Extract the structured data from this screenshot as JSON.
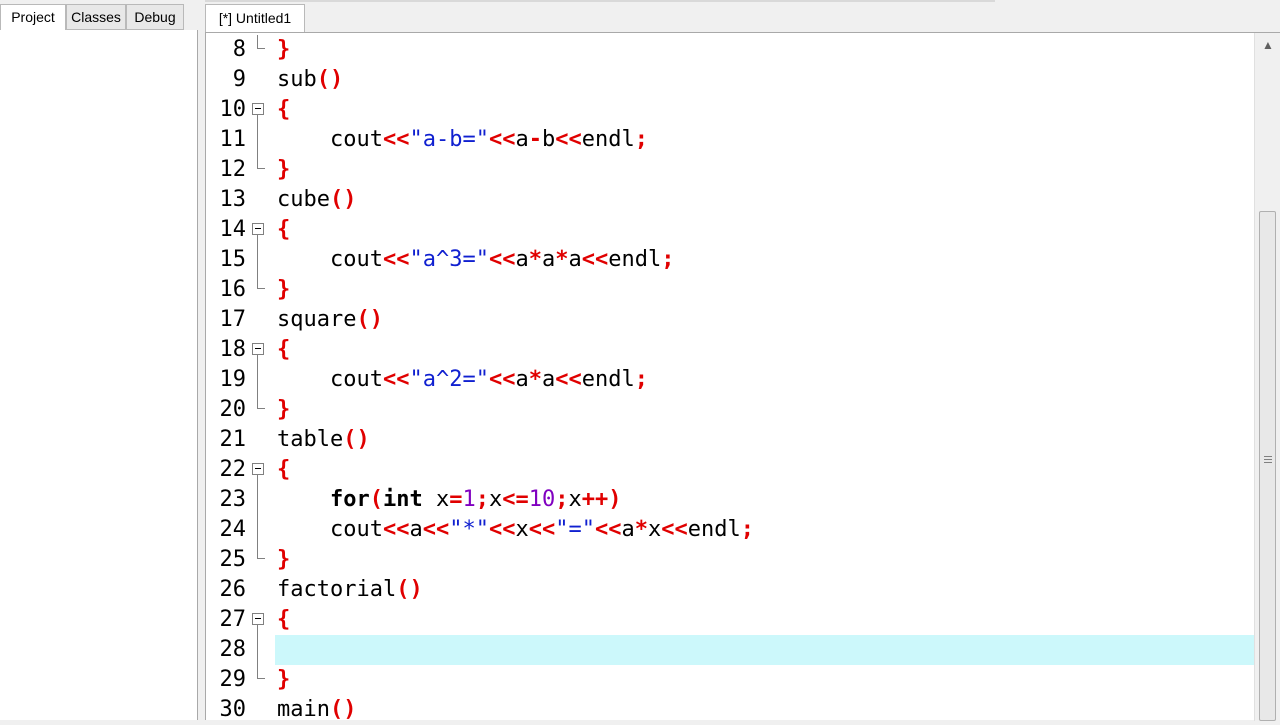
{
  "left_panel": {
    "tabs": [
      "Project",
      "Classes",
      "Debug"
    ],
    "active_tab": "Project"
  },
  "editor": {
    "file_tab_label": "[*] Untitled1",
    "current_line": 28,
    "lines": [
      {
        "n": "8",
        "fold": "end",
        "tokens": [
          [
            "}",
            "punct"
          ]
        ]
      },
      {
        "n": "9",
        "fold": "",
        "tokens": [
          [
            "sub",
            "plain"
          ],
          [
            "()",
            "punct"
          ]
        ]
      },
      {
        "n": "10",
        "fold": "start",
        "tokens": [
          [
            "{",
            "punct"
          ]
        ]
      },
      {
        "n": "11",
        "fold": "mid",
        "tokens": [
          [
            "    cout",
            "plain"
          ],
          [
            "<<",
            "punct"
          ],
          [
            "\"a-b=\"",
            "str"
          ],
          [
            "<<",
            "punct"
          ],
          [
            "a",
            "plain"
          ],
          [
            "-",
            "punct"
          ],
          [
            "b",
            "plain"
          ],
          [
            "<<",
            "punct"
          ],
          [
            "endl",
            "plain"
          ],
          [
            ";",
            "punct"
          ]
        ]
      },
      {
        "n": "12",
        "fold": "end",
        "tokens": [
          [
            "}",
            "punct"
          ]
        ]
      },
      {
        "n": "13",
        "fold": "",
        "tokens": [
          [
            "cube",
            "plain"
          ],
          [
            "()",
            "punct"
          ]
        ]
      },
      {
        "n": "14",
        "fold": "start",
        "tokens": [
          [
            "{",
            "punct"
          ]
        ]
      },
      {
        "n": "15",
        "fold": "mid",
        "tokens": [
          [
            "    cout",
            "plain"
          ],
          [
            "<<",
            "punct"
          ],
          [
            "\"a^3=\"",
            "str"
          ],
          [
            "<<",
            "punct"
          ],
          [
            "a",
            "plain"
          ],
          [
            "*",
            "punct"
          ],
          [
            "a",
            "plain"
          ],
          [
            "*",
            "punct"
          ],
          [
            "a",
            "plain"
          ],
          [
            "<<",
            "punct"
          ],
          [
            "endl",
            "plain"
          ],
          [
            ";",
            "punct"
          ]
        ]
      },
      {
        "n": "16",
        "fold": "end",
        "tokens": [
          [
            "}",
            "punct"
          ]
        ]
      },
      {
        "n": "17",
        "fold": "",
        "tokens": [
          [
            "square",
            "plain"
          ],
          [
            "()",
            "punct"
          ]
        ]
      },
      {
        "n": "18",
        "fold": "start",
        "tokens": [
          [
            "{",
            "punct"
          ]
        ]
      },
      {
        "n": "19",
        "fold": "mid",
        "tokens": [
          [
            "    cout",
            "plain"
          ],
          [
            "<<",
            "punct"
          ],
          [
            "\"a^2=\"",
            "str"
          ],
          [
            "<<",
            "punct"
          ],
          [
            "a",
            "plain"
          ],
          [
            "*",
            "punct"
          ],
          [
            "a",
            "plain"
          ],
          [
            "<<",
            "punct"
          ],
          [
            "endl",
            "plain"
          ],
          [
            ";",
            "punct"
          ]
        ]
      },
      {
        "n": "20",
        "fold": "end",
        "tokens": [
          [
            "}",
            "punct"
          ]
        ]
      },
      {
        "n": "21",
        "fold": "",
        "tokens": [
          [
            "table",
            "plain"
          ],
          [
            "()",
            "punct"
          ]
        ]
      },
      {
        "n": "22",
        "fold": "start",
        "tokens": [
          [
            "{",
            "punct"
          ]
        ]
      },
      {
        "n": "23",
        "fold": "mid",
        "tokens": [
          [
            "    ",
            "plain"
          ],
          [
            "for",
            "kw"
          ],
          [
            "(",
            "punct"
          ],
          [
            "int",
            "kw"
          ],
          [
            " x",
            "plain"
          ],
          [
            "=",
            "punct"
          ],
          [
            "1",
            "num"
          ],
          [
            ";",
            "punct"
          ],
          [
            "x",
            "plain"
          ],
          [
            "<=",
            "punct"
          ],
          [
            "10",
            "num"
          ],
          [
            ";",
            "punct"
          ],
          [
            "x",
            "plain"
          ],
          [
            "++)",
            "punct"
          ]
        ]
      },
      {
        "n": "24",
        "fold": "mid",
        "tokens": [
          [
            "    cout",
            "plain"
          ],
          [
            "<<",
            "punct"
          ],
          [
            "a",
            "plain"
          ],
          [
            "<<",
            "punct"
          ],
          [
            "\"*\"",
            "str"
          ],
          [
            "<<",
            "punct"
          ],
          [
            "x",
            "plain"
          ],
          [
            "<<",
            "punct"
          ],
          [
            "\"=\"",
            "str"
          ],
          [
            "<<",
            "punct"
          ],
          [
            "a",
            "plain"
          ],
          [
            "*",
            "punct"
          ],
          [
            "x",
            "plain"
          ],
          [
            "<<",
            "punct"
          ],
          [
            "endl",
            "plain"
          ],
          [
            ";",
            "punct"
          ]
        ]
      },
      {
        "n": "25",
        "fold": "end",
        "tokens": [
          [
            "}",
            "punct"
          ]
        ]
      },
      {
        "n": "26",
        "fold": "",
        "tokens": [
          [
            "factorial",
            "plain"
          ],
          [
            "()",
            "punct"
          ]
        ]
      },
      {
        "n": "27",
        "fold": "start",
        "tokens": [
          [
            "{",
            "punct"
          ]
        ]
      },
      {
        "n": "28",
        "fold": "mid",
        "tokens": []
      },
      {
        "n": "29",
        "fold": "end",
        "tokens": [
          [
            "}",
            "punct"
          ]
        ]
      },
      {
        "n": "30",
        "fold": "",
        "tokens": [
          [
            "main",
            "plain"
          ],
          [
            "()",
            "punct"
          ]
        ]
      }
    ]
  },
  "colors": {
    "punct": "#e00000",
    "string": "#1020d0",
    "number": "#8000c0",
    "current_line_bg": "#ccf8fb"
  }
}
